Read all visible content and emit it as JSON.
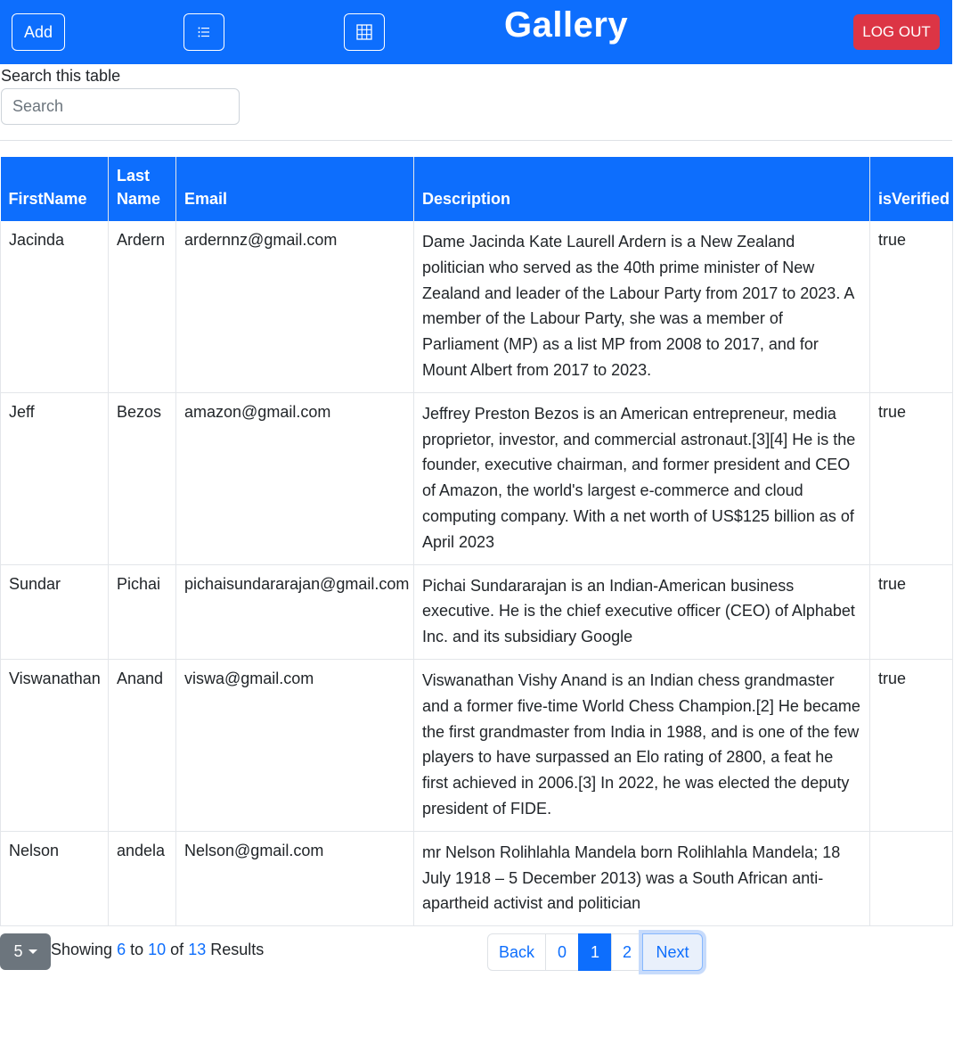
{
  "navbar": {
    "add_label": "Add",
    "list_icon": "list-icon",
    "grid_icon": "grid-icon",
    "title": "Gallery",
    "logout_label": "LOG OUT",
    "color": "#0d6efd",
    "logout_color": "#dc3545"
  },
  "search": {
    "label": "Search this table",
    "placeholder": "Search",
    "value": ""
  },
  "table": {
    "headers": {
      "first_name": "FirstName",
      "last_name": "Last Name",
      "email": "Email",
      "description": "Description",
      "is_verified": "isVerified"
    },
    "rows": [
      {
        "first_name": "Jacinda",
        "last_name": "Ardern",
        "email": "ardernnz@gmail.com",
        "description": "Dame Jacinda Kate Laurell Ardern is a New Zealand politician who served as the 40th prime minister of New Zealand and leader of the Labour Party from 2017 to 2023. A member of the Labour Party, she was a member of Parliament (MP) as a list MP from 2008 to 2017, and for Mount Albert from 2017 to 2023.",
        "is_verified": "true"
      },
      {
        "first_name": "Jeff",
        "last_name": "Bezos",
        "email": "amazon@gmail.com",
        "description": "Jeffrey Preston Bezos is an American entrepreneur, media proprietor, investor, and commercial astronaut.[3][4] He is the founder, executive chairman, and former president and CEO of Amazon, the world's largest e-commerce and cloud computing company. With a net worth of US$125 billion as of April 2023",
        "is_verified": "true"
      },
      {
        "first_name": "Sundar",
        "last_name": "Pichai",
        "email": "pichaisundararajan@gmail.com",
        "description": "Pichai Sundararajan is an Indian-American business executive. He is the chief executive officer (CEO) of Alphabet Inc. and its subsidiary Google",
        "is_verified": "true"
      },
      {
        "first_name": "Viswanathan",
        "last_name": "Anand",
        "email": "viswa@gmail.com",
        "description": "Viswanathan Vishy Anand is an Indian chess grandmaster and a former five-time World Chess Champion.[2] He became the first grandmaster from India in 1988, and is one of the few players to have surpassed an Elo rating of 2800, a feat he first achieved in 2006.[3] In 2022, he was elected the deputy president of FIDE.",
        "is_verified": "true"
      },
      {
        "first_name": "Nelson",
        "last_name": "andela",
        "email": "Nelson@gmail.com",
        "description": "mr Nelson Rolihlahla Mandela born Rolihlahla Mandela; 18 July 1918 – 5 December 2013) was a South African anti-apartheid activist and politician",
        "is_verified": ""
      }
    ]
  },
  "footer": {
    "page_size": "5",
    "showing_prefix": "Showing",
    "from": "6",
    "to_word": "to",
    "to": "10",
    "of_word": "of",
    "total": "13",
    "results_word": "Results",
    "pagination": {
      "back": "Back",
      "pages": [
        "0",
        "1",
        "2"
      ],
      "active_page": "1",
      "next": "Next"
    }
  }
}
